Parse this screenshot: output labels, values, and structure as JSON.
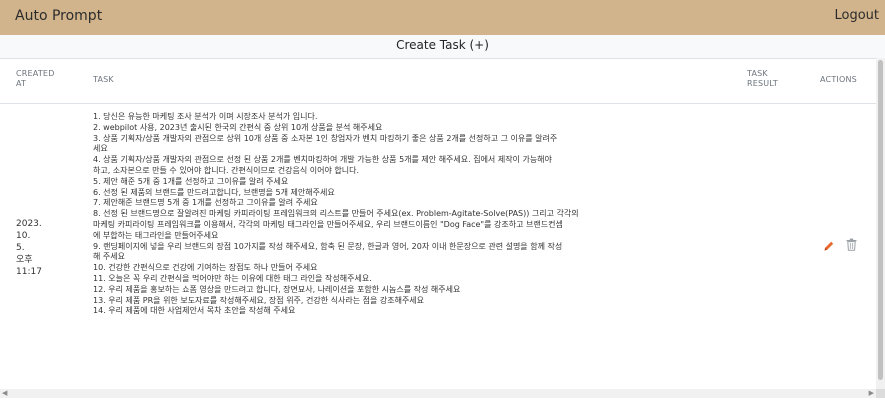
{
  "app": {
    "title": "Auto Prompt",
    "logout_label": "Logout"
  },
  "toolbar": {
    "create_label": "Create Task (+)"
  },
  "table": {
    "headers": {
      "created_line1": "CREATED",
      "created_line2": "AT",
      "task": "TASK",
      "result_line1": "TASK",
      "result_line2": "RESULT",
      "actions": "ACTIONS"
    },
    "rows": [
      {
        "created": {
          "l1": "2023. 10.",
          "l2": "5.",
          "l3": "오후",
          "l4": "11:17"
        },
        "task_lines": [
          "1. 당신은 유능한 마케팅 조사 분석가 이며 시장조사 분석가 입니다.",
          "2. webpilot 사용, 2023년 출시된 한국의 간편식 중 상위 10개 상품을 분석 해주세요",
          "3. 상품 기획자/상품 개발자의 관점으로 상위 10개 상품 중 소자본 1인 창업자가 벤치 마킹하기 좋은 상품 2개를 선정하고 그 이유를 알려주",
          "세요",
          "4. 상품 기획자/상품 개발자의 관점으로 선정 된 상품 2개를 벤치마킹하여 개발 가능한 상품 5개를 제안 해주세요. 집에서 제작이 가능해야",
          "하고, 소자본으로 만들 수 있어야 합니다. 간편식이므로 건강음식 이어야 합니다.",
          "5. 제안 해준 5개 중 1개를 선정하고 그이유를 알려 주세요",
          "6. 선정 된 제품의 브랜드를 만드려고합니다, 브랜명을 5개 제안해주세요",
          "7. 제안해준 브랜드명 5개 중 1개를 선정하고 그이유를 알려 주세요",
          "8. 선정 된 브랜드명으로 잘알려진 마케팅 카피라이팅 프레임워크의 리스트를 만들어 주세요(ex. Problem-Agitate-Solve(PAS)) 그리고 각각의",
          "마케팅 카피라이팅 프레임워크를 이용해서, 각각의 마케팅 태그라인을 만들어주세요, 우리 브랜드이름인 \"Dog Face\"를 강조하고 브랜드컨셉",
          "에 부합하는 태그라인을 만들어주세요",
          "9. 랜딩페이지에 넣을 우리 브랜드의 장점 10가지를 작성 해주세요, 함축 된 문장, 한글과 영어, 20자 이내 한문장으로 관련 설명을 함께 작성",
          "해 주세요",
          "10. 건강한 간편식으로 건강에 기여하는 장점도 하나 만들어 주세요",
          "11. 오늘은 꼭 우리 간편식을 먹어야만 하는 이유에 대한 태그 라인을 작성해주세요.",
          "12. 우리 제품을 홍보하는 쇼폼 영상을 만드려고 합니다, 장면묘사, 나레이션을 포함한 시놉스를 작성 해주세요",
          "13. 우리 제품 PR을 위한 보도자료를 작성해주세요, 장점 위주, 건강한 식사라는 점을 강조해주세요",
          "14. 우리 제품에 대한 사업제안서 목차 초안을 작성해 주세요"
        ],
        "task_result": "",
        "actions": {
          "edit_icon": "pencil-icon",
          "delete_icon": "trash-icon"
        }
      }
    ]
  },
  "colors": {
    "topbar": "#d2b48c",
    "edit": "#e8662a",
    "delete": "#9aa0a6"
  }
}
